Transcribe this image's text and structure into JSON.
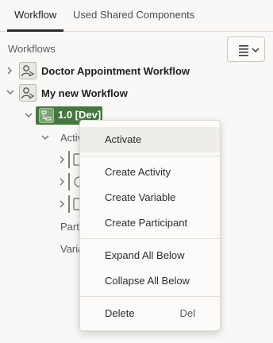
{
  "tabs": [
    {
      "label": "Workflow",
      "active": true
    },
    {
      "label": "Used Shared Components",
      "active": false
    }
  ],
  "tree": {
    "section_title": "Workflows",
    "workflows": [
      {
        "label": "Doctor Appointment Workflow",
        "expanded": false
      },
      {
        "label": "My new Workflow",
        "expanded": true
      }
    ],
    "version_node": {
      "label": "1.0 [Dev]",
      "selected": true
    },
    "activities_label": "Activi",
    "participants_label": "Parti",
    "variables_label": "Varia"
  },
  "context_menu": {
    "items": [
      {
        "label": "Activate",
        "highlighted": true
      },
      {
        "label": "Create Activity"
      },
      {
        "label": "Create Variable"
      },
      {
        "label": "Create Participant"
      },
      {
        "label": "Expand All Below"
      },
      {
        "label": "Collapse All Below"
      },
      {
        "label": "Delete",
        "shortcut": "Del"
      }
    ]
  },
  "colors": {
    "selected_node": "#44783e",
    "background": "#f9f8f6",
    "menu_highlight": "#efedea"
  },
  "icons": {
    "menu_button": "hamburger-menu-icon",
    "dropdown": "chevron-down-icon",
    "workflow": "workflow-person-icon",
    "version": "version-tree-icon"
  }
}
